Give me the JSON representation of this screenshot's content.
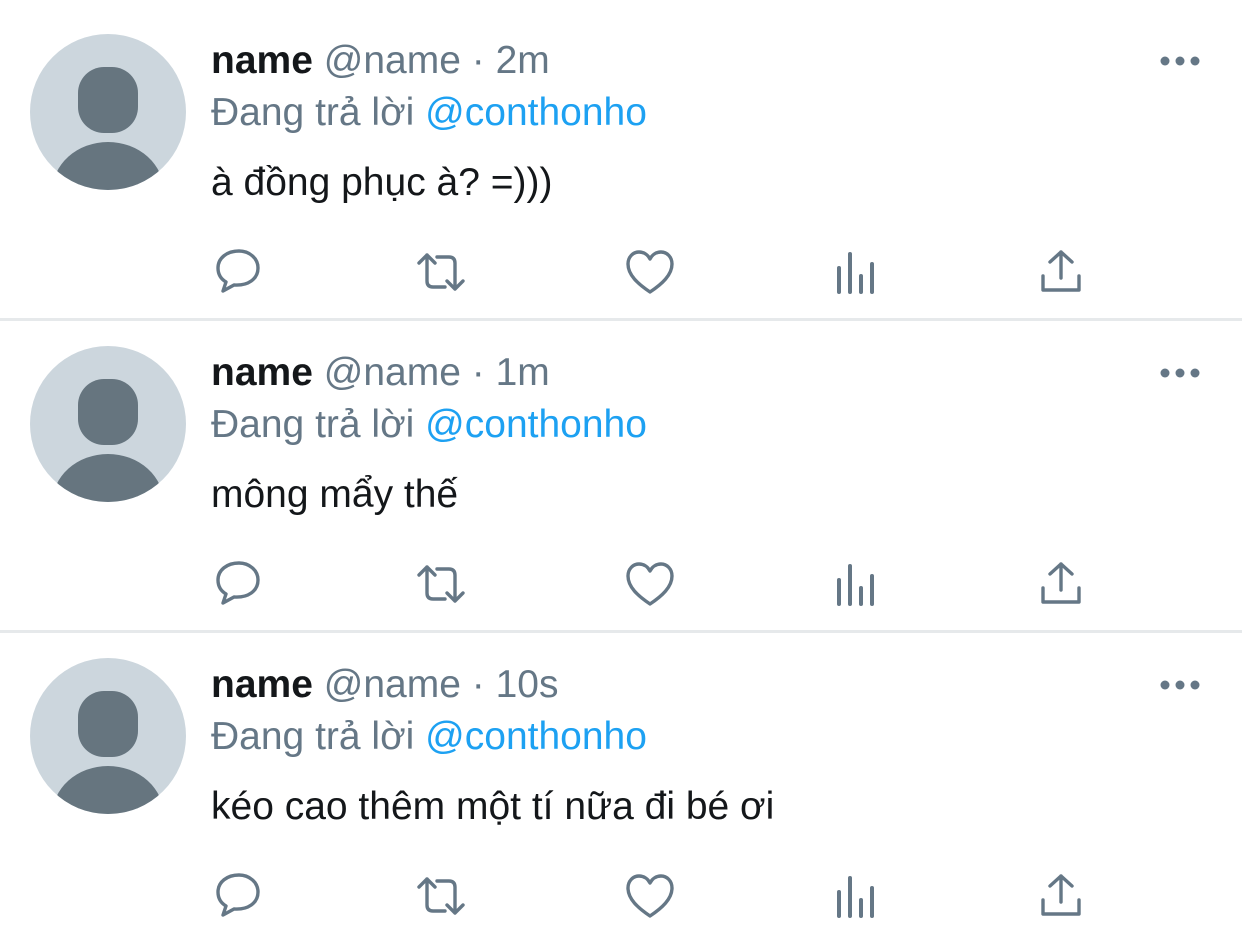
{
  "tweets": [
    {
      "display_name": "name",
      "handle": "@name",
      "separator": "·",
      "time": "2m",
      "reply_prefix": "Đang trả lời",
      "reply_to": "@conthonho",
      "text": "à đồng phục à? =)))"
    },
    {
      "display_name": "name",
      "handle": "@name",
      "separator": "·",
      "time": "1m",
      "reply_prefix": "Đang trả lời",
      "reply_to": "@conthonho",
      "text": "mông mẩy thế"
    },
    {
      "display_name": "name",
      "handle": "@name",
      "separator": "·",
      "time": "10s",
      "reply_prefix": "Đang trả lời",
      "reply_to": "@conthonho",
      "text": "kéo cao thêm một tí nữa đi bé ơi"
    }
  ],
  "icons": {
    "more": "more-horizontal-icon",
    "reply": "reply-bubble-icon",
    "retweet": "retweet-icon",
    "like": "heart-icon",
    "stats": "analytics-icon",
    "share": "share-icon"
  },
  "colors": {
    "text_primary": "#14171a",
    "text_secondary": "#657786",
    "accent": "#1da1f2",
    "avatar_bg": "#ccd6dd",
    "avatar_fg": "#66757f",
    "divider": "#e6e9eb"
  }
}
